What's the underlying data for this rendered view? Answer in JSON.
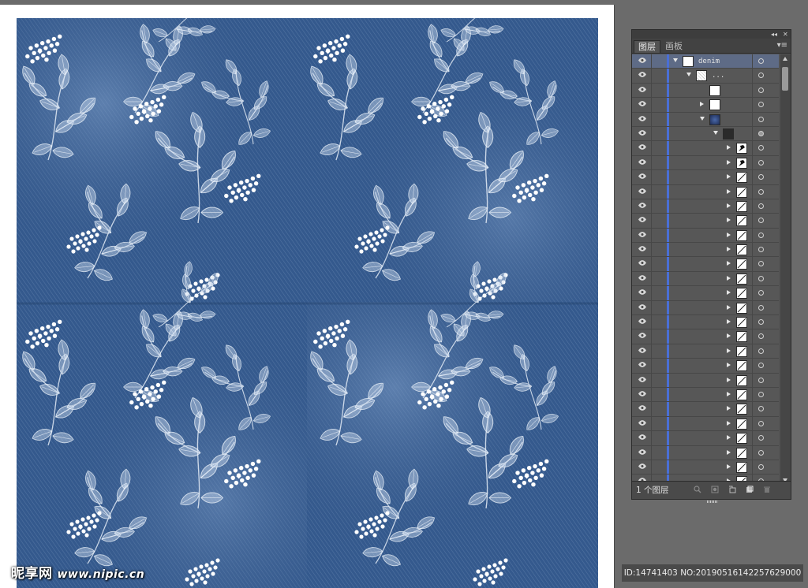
{
  "watermark": {
    "brand": "昵享网",
    "url": "www.nipic.cn"
  },
  "image_id": "ID:14741403 NO:20190516142257629000",
  "artwork": {
    "colors": {
      "denim_dark": "#2d4f80",
      "denim_light": "#6f93c0",
      "flower": "#ffffff"
    },
    "motif": "white leafy branches with berry clusters on blue denim"
  },
  "layers_panel": {
    "tabs": [
      {
        "label": "图层",
        "active": true
      },
      {
        "label": "画板",
        "active": false
      }
    ],
    "title_controls": {
      "collapse": "◂◂",
      "close": "✕"
    },
    "menu_icon": "panel-menu-icon",
    "rows": [
      {
        "name": "denim",
        "indent": 0,
        "arrow": "down",
        "thumb": "white",
        "selected": true,
        "target_filled": false
      },
      {
        "name": "...",
        "indent": 1,
        "arrow": "down",
        "thumb": "speck",
        "selected": false,
        "target_filled": false
      },
      {
        "name": "",
        "indent": 2,
        "arrow": "none",
        "thumb": "white",
        "selected": false,
        "target_filled": false
      },
      {
        "name": "",
        "indent": 2,
        "arrow": "right",
        "thumb": "white",
        "selected": false,
        "target_filled": false
      },
      {
        "name": "",
        "indent": 2,
        "arrow": "down",
        "thumb": "blue",
        "selected": false,
        "target_filled": false
      },
      {
        "name": "",
        "indent": 3,
        "arrow": "down",
        "thumb": "dark",
        "selected": false,
        "target_filled": true
      },
      {
        "name": "",
        "indent": 4,
        "arrow": "right",
        "thumb": "shape",
        "selected": false,
        "target_filled": false
      },
      {
        "name": "",
        "indent": 4,
        "arrow": "right",
        "thumb": "shape",
        "selected": false,
        "target_filled": false
      },
      {
        "name": "",
        "indent": 4,
        "arrow": "right",
        "thumb": "line",
        "selected": false,
        "target_filled": false
      },
      {
        "name": "",
        "indent": 4,
        "arrow": "right",
        "thumb": "line",
        "selected": false,
        "target_filled": false
      },
      {
        "name": "",
        "indent": 4,
        "arrow": "right",
        "thumb": "line",
        "selected": false,
        "target_filled": false
      },
      {
        "name": "",
        "indent": 4,
        "arrow": "right",
        "thumb": "line",
        "selected": false,
        "target_filled": false
      },
      {
        "name": "",
        "indent": 4,
        "arrow": "right",
        "thumb": "line",
        "selected": false,
        "target_filled": false
      },
      {
        "name": "",
        "indent": 4,
        "arrow": "right",
        "thumb": "line",
        "selected": false,
        "target_filled": false
      },
      {
        "name": "",
        "indent": 4,
        "arrow": "right",
        "thumb": "line",
        "selected": false,
        "target_filled": false
      },
      {
        "name": "",
        "indent": 4,
        "arrow": "right",
        "thumb": "line",
        "selected": false,
        "target_filled": false
      },
      {
        "name": "",
        "indent": 4,
        "arrow": "right",
        "thumb": "line",
        "selected": false,
        "target_filled": false
      },
      {
        "name": "",
        "indent": 4,
        "arrow": "right",
        "thumb": "line",
        "selected": false,
        "target_filled": false
      },
      {
        "name": "",
        "indent": 4,
        "arrow": "right",
        "thumb": "line",
        "selected": false,
        "target_filled": false
      },
      {
        "name": "",
        "indent": 4,
        "arrow": "right",
        "thumb": "line",
        "selected": false,
        "target_filled": false
      },
      {
        "name": "",
        "indent": 4,
        "arrow": "right",
        "thumb": "line",
        "selected": false,
        "target_filled": false
      },
      {
        "name": "",
        "indent": 4,
        "arrow": "right",
        "thumb": "line",
        "selected": false,
        "target_filled": false
      },
      {
        "name": "",
        "indent": 4,
        "arrow": "right",
        "thumb": "line",
        "selected": false,
        "target_filled": false
      },
      {
        "name": "",
        "indent": 4,
        "arrow": "right",
        "thumb": "line",
        "selected": false,
        "target_filled": false
      },
      {
        "name": "",
        "indent": 4,
        "arrow": "right",
        "thumb": "line",
        "selected": false,
        "target_filled": false
      },
      {
        "name": "",
        "indent": 4,
        "arrow": "right",
        "thumb": "line",
        "selected": false,
        "target_filled": false
      },
      {
        "name": "",
        "indent": 4,
        "arrow": "right",
        "thumb": "line",
        "selected": false,
        "target_filled": false
      },
      {
        "name": "",
        "indent": 4,
        "arrow": "right",
        "thumb": "line",
        "selected": false,
        "target_filled": false
      },
      {
        "name": "",
        "indent": 4,
        "arrow": "right",
        "thumb": "line",
        "selected": false,
        "target_filled": false
      },
      {
        "name": "",
        "indent": 4,
        "arrow": "right",
        "thumb": "line",
        "selected": false,
        "target_filled": false
      }
    ],
    "footer": {
      "layer_count": "1 个图层",
      "icons": [
        "locate-object-icon",
        "make-clipping-mask-icon",
        "new-sublayer-icon",
        "new-layer-icon",
        "delete-layer-icon"
      ]
    }
  }
}
